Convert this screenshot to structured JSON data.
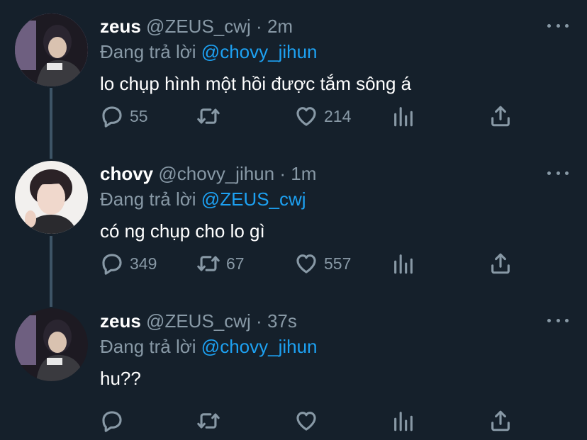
{
  "reply_prefix": "Đang trả lời",
  "colors": {
    "background": "#15202b",
    "secondary": "#8899a6",
    "accent": "#1da1f2",
    "thread_line": "#3d5466"
  },
  "tweets": [
    {
      "name": "zeus",
      "handle": "@ZEUS_cwj",
      "dot": "·",
      "time": "2m",
      "reply_to": "@chovy_jihun",
      "text": "lo chụp hình một hồi được tắm sông á",
      "replies": "55",
      "retweets": "",
      "likes": "214",
      "icons": [
        "reply-icon",
        "retweet-icon",
        "like-icon",
        "analytics-icon",
        "share-icon"
      ]
    },
    {
      "name": "chovy",
      "handle": "@chovy_jihun",
      "dot": "·",
      "time": "1m",
      "reply_to": "@ZEUS_cwj",
      "text": "có ng chụp cho lo gì",
      "replies": "349",
      "retweets": "67",
      "likes": "557",
      "icons": [
        "reply-icon",
        "retweet-icon",
        "like-icon",
        "analytics-icon",
        "share-icon"
      ]
    },
    {
      "name": "zeus",
      "handle": "@ZEUS_cwj",
      "dot": "·",
      "time": "37s",
      "reply_to": "@chovy_jihun",
      "text": "hu??",
      "replies": "",
      "retweets": "",
      "likes": "",
      "icons": [
        "reply-icon",
        "retweet-icon",
        "like-icon",
        "analytics-icon",
        "share-icon"
      ]
    }
  ]
}
